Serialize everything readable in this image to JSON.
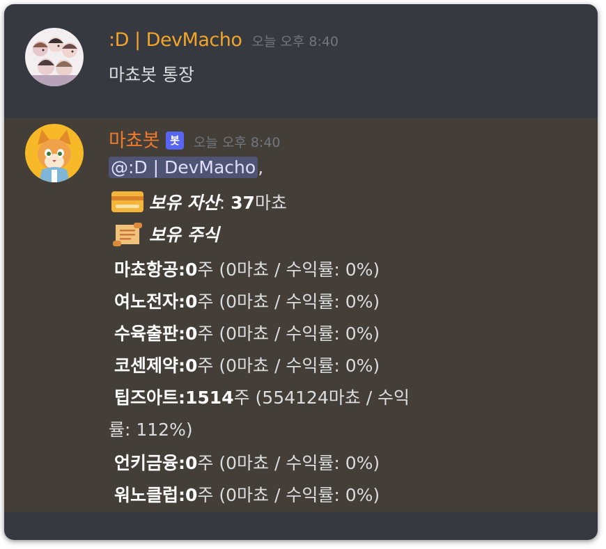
{
  "messages": [
    {
      "username": ":D | DevMacho",
      "timestamp": "오늘 오후 8:40",
      "content": "마쵸봇 통장"
    },
    {
      "username": "마쵸봇",
      "bot_tag": "봇",
      "timestamp": "오늘 오후 8:40",
      "mention": "@:D | DevMacho",
      "mention_suffix": ",",
      "assets": {
        "icon": "credit-card-emoji",
        "label": "보유 자산",
        "colon": ":",
        "amount": "37",
        "unit": "마쵸"
      },
      "stocks_header": {
        "icon": "scroll-emoji",
        "label": "보유 주식"
      },
      "stocks": [
        {
          "name": "마쵸항공:",
          "shares": "0",
          "unit": "주",
          "detail": " (0마쵸 / 수익률: 0%)"
        },
        {
          "name": "여노전자:",
          "shares": "0",
          "unit": "주",
          "detail": " (0마쵸 / 수익률: 0%)"
        },
        {
          "name": "수육출판:",
          "shares": "0",
          "unit": "주",
          "detail": " (0마쵸 / 수익률: 0%)"
        },
        {
          "name": "코센제약:",
          "shares": "0",
          "unit": "주",
          "detail": " (0마쵸 / 수익률: 0%)"
        },
        {
          "name": "팁즈아트:",
          "shares": "1514",
          "unit": "주",
          "detail": " (554124마쵸 / 수익",
          "detail_wrap": "률: 112%)"
        },
        {
          "name": "언키금융:",
          "shares": "0",
          "unit": "주",
          "detail": " (0마쵸 / 수익률: 0%)"
        },
        {
          "name": "워노클럽:",
          "shares": "0",
          "unit": "주",
          "detail": " (0마쵸 / 수익률: 0%)"
        }
      ]
    }
  ],
  "colors": {
    "background": "#36393f",
    "bot_message_bg": "#433f38",
    "dev_username": "#f2a52a",
    "bot_username": "#ef7a2e",
    "bot_tag": "#5865f2",
    "timestamp": "#72767d",
    "mention_bg": "#4f5374"
  }
}
